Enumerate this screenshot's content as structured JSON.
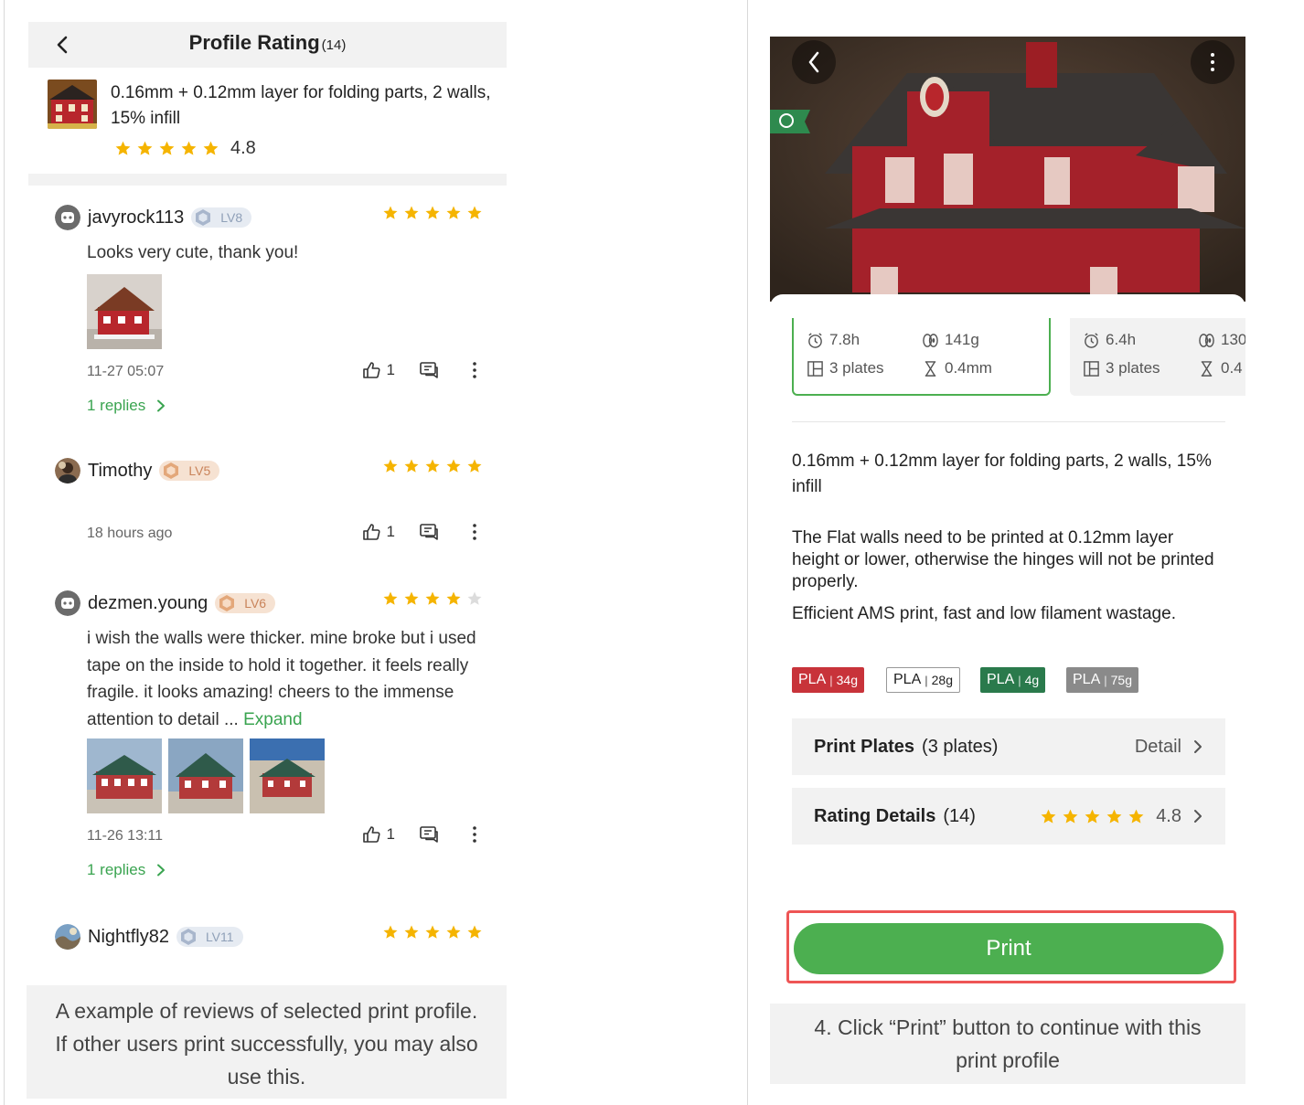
{
  "left": {
    "header": {
      "title": "Profile Rating",
      "count": "(14)"
    },
    "summary": {
      "title": "0.16mm + 0.12mm layer for folding parts, 2 walls, 15% infill",
      "rating": "4.8",
      "stars": 5
    },
    "reviews": [
      {
        "user": "javyrock113",
        "level": "LV8",
        "level_color": "blue",
        "stars": 5,
        "text": "Looks very cute, thank you!",
        "photos": 1,
        "time": "11-27 05:07",
        "likes": "1",
        "replies": "1 replies"
      },
      {
        "user": "Timothy",
        "level": "LV5",
        "level_color": "orange",
        "stars": 5,
        "text": "",
        "photos": 0,
        "time": "18 hours ago",
        "likes": "1",
        "replies": ""
      },
      {
        "user": "dezmen.young",
        "level": "LV6",
        "level_color": "orange",
        "stars": 4,
        "text": "i wish the walls were thicker. mine broke but i used tape on the inside to hold it together. it feels really fragile. it looks amazing! cheers to the immense attention to detail ...",
        "expand": "Expand",
        "photos": 3,
        "time": "11-26 13:11",
        "likes": "1",
        "replies": "1 replies"
      },
      {
        "user": "Nightfly82",
        "level": "LV11",
        "level_color": "blue",
        "stars": 5
      }
    ],
    "caption": "A example of reviews of selected print profile. If other users print successfully, you may also use this."
  },
  "right": {
    "options": [
      {
        "time": "7.8h",
        "weight": "141g",
        "plates": "3 plates",
        "nozzle": "0.4mm",
        "selected": true
      },
      {
        "time": "6.4h",
        "weight": "130",
        "plates": "3 plates",
        "nozzle": "0.4",
        "selected": false
      }
    ],
    "description": {
      "title": "0.16mm + 0.12mm layer for folding parts, 2 walls, 15% infill",
      "p1": "The Flat walls need to be printed at 0.12mm layer height or lower, otherwise the hinges will not be printed properly.",
      "p2": "Efficient AMS print, fast and low filament wastage."
    },
    "filaments": [
      {
        "type": "PLA",
        "sep": "|",
        "weight": "34g",
        "bg": "#c8333a",
        "fg": "#ffffff"
      },
      {
        "type": "PLA",
        "sep": "|",
        "weight": "28g",
        "bg": "#ffffff",
        "fg": "#222222"
      },
      {
        "type": "PLA",
        "sep": "|",
        "weight": "4g",
        "bg": "#2a7a4c",
        "fg": "#ffffff"
      },
      {
        "type": "PLA",
        "sep": "|",
        "weight": "75g",
        "bg": "#8a8a8a",
        "fg": "#ffffff"
      }
    ],
    "print_plates": {
      "label": "Print Plates",
      "sub": "(3 plates)",
      "action": "Detail"
    },
    "rating_details": {
      "label": "Rating Details",
      "sub": "(14)",
      "rating": "4.8",
      "stars": 5
    },
    "print_button": "Print",
    "caption": "4. Click “Print” button to continue with this print profile"
  }
}
